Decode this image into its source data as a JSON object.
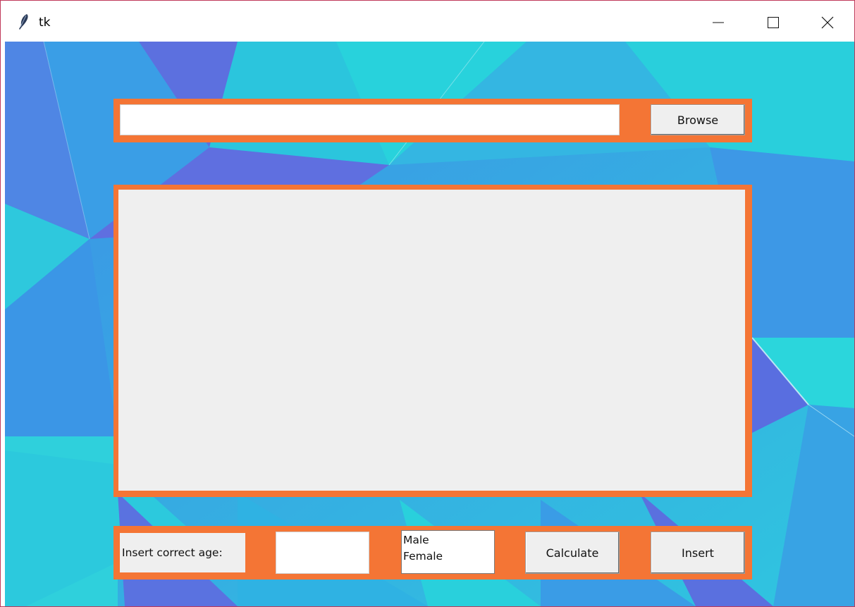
{
  "window": {
    "title": "tk",
    "titlebar_icon": "feather-icon",
    "controls": [
      "minimize-icon",
      "maximize-icon",
      "close-icon"
    ]
  },
  "colors": {
    "frame_orange": "#f47535",
    "widget_gray": "#efefef",
    "bg_cyan": "#2cd3dc",
    "bg_blue": "#3e94e6",
    "bg_purple": "#5a74e0"
  },
  "top_bar": {
    "path_value": "",
    "browse_label": "Browse"
  },
  "bottom_bar": {
    "age_label": "Insert correct age:",
    "age_value": "",
    "gender_options": [
      "Male",
      "Female"
    ],
    "calculate_label": "Calculate",
    "insert_label": "Insert"
  }
}
